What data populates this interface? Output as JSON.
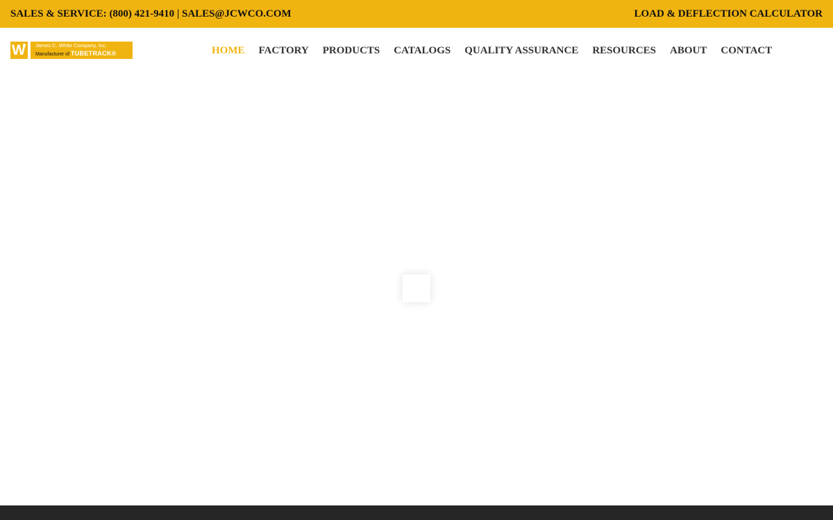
{
  "topbar": {
    "sales_label": "SALES & SERVICE:",
    "phone": "(800) 421-9410",
    "separator": "|",
    "email": "SALES@JCWCO.COM",
    "calculator_link": "LOAD & DEFLECTION CALCULATOR"
  },
  "logo": {
    "mark": "W",
    "company": "James C. White Company, Inc.",
    "manufacturer_prefix": "Manufacturer of",
    "brand": "TUBETRACK®"
  },
  "nav": {
    "items": [
      {
        "label": "HOME",
        "active": true
      },
      {
        "label": "FACTORY"
      },
      {
        "label": "PRODUCTS"
      },
      {
        "label": "CATALOGS"
      },
      {
        "label": "QUALITY ASSURANCE"
      },
      {
        "label": "RESOURCES"
      },
      {
        "label": "ABOUT"
      },
      {
        "label": "CONTACT"
      }
    ]
  },
  "colors": {
    "accent": "#f0b411",
    "nav_text": "#333333",
    "footer": "#262626"
  }
}
